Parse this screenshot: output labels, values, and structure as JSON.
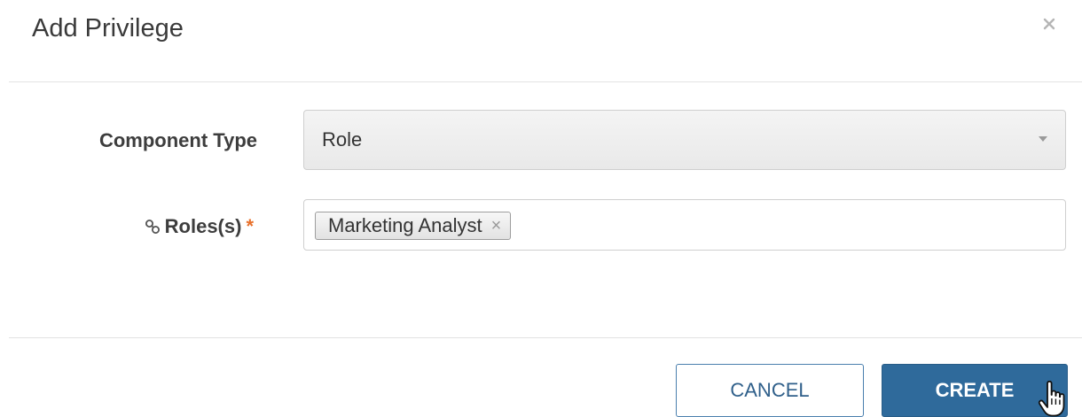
{
  "dialog": {
    "title": "Add Privilege"
  },
  "form": {
    "component_type": {
      "label": "Component Type",
      "selected": "Role"
    },
    "roles": {
      "label": "Roles(s)",
      "required_marker": "*",
      "tags": [
        {
          "label": "Marketing Analyst",
          "remove_glyph": "×"
        }
      ]
    }
  },
  "footer": {
    "cancel_label": "CANCEL",
    "create_label": "CREATE"
  },
  "icons": {
    "close": "close-icon",
    "roles": "link-icon",
    "caret": "caret-down-icon",
    "cursor": "hand-pointer-icon"
  },
  "colors": {
    "primary": "#2f6a9b",
    "required": "#e8702a",
    "border": "#cfcfcf"
  }
}
